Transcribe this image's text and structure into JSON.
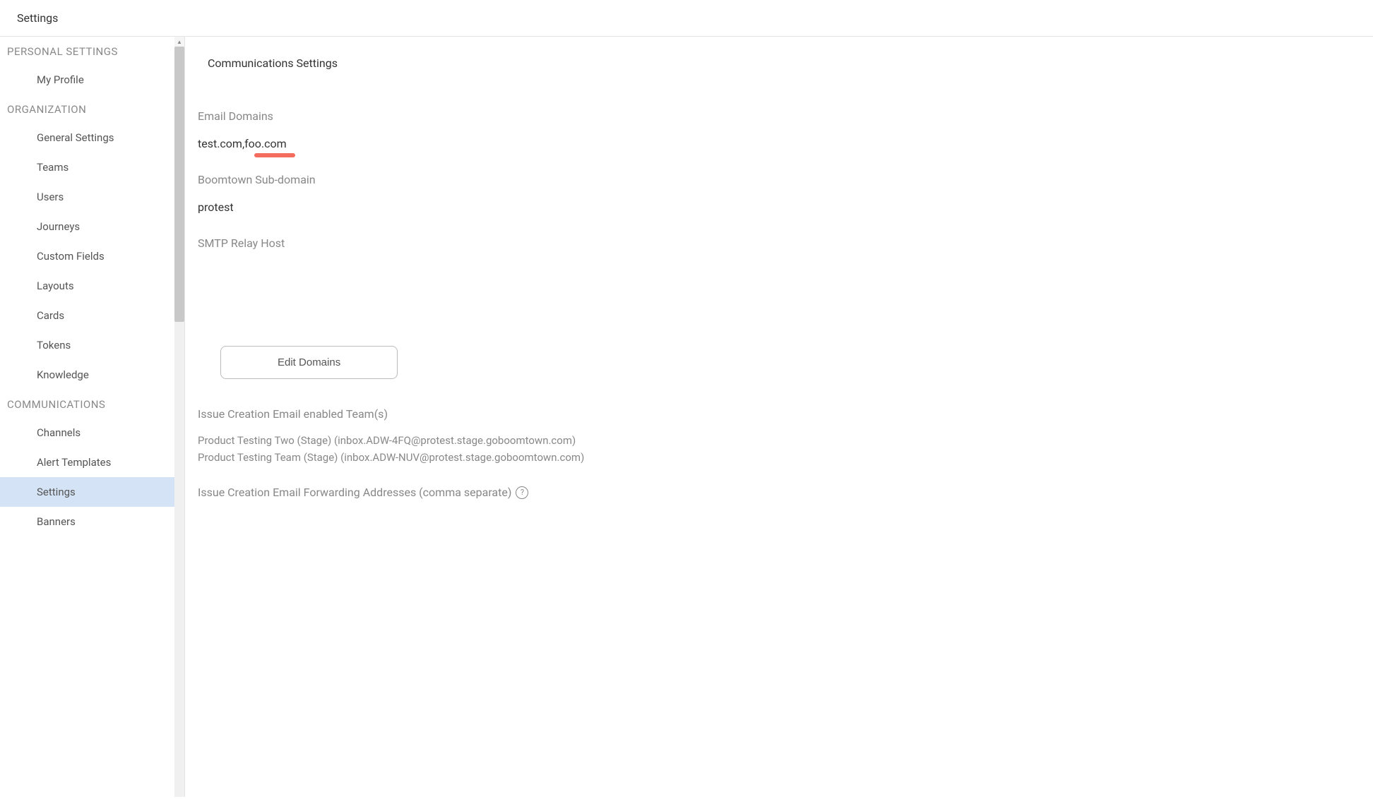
{
  "header": {
    "title": "Settings"
  },
  "sidebar": {
    "sections": [
      {
        "header": "PERSONAL SETTINGS",
        "items": [
          {
            "label": "My Profile",
            "key": "my-profile"
          }
        ]
      },
      {
        "header": "ORGANIZATION",
        "items": [
          {
            "label": "General Settings",
            "key": "general-settings"
          },
          {
            "label": "Teams",
            "key": "teams"
          },
          {
            "label": "Users",
            "key": "users"
          },
          {
            "label": "Journeys",
            "key": "journeys"
          },
          {
            "label": "Custom Fields",
            "key": "custom-fields"
          },
          {
            "label": "Layouts",
            "key": "layouts"
          },
          {
            "label": "Cards",
            "key": "cards"
          },
          {
            "label": "Tokens",
            "key": "tokens"
          },
          {
            "label": "Knowledge",
            "key": "knowledge"
          }
        ]
      },
      {
        "header": "COMMUNICATIONS",
        "items": [
          {
            "label": "Channels",
            "key": "channels"
          },
          {
            "label": "Alert Templates",
            "key": "alert-templates"
          },
          {
            "label": "Settings",
            "key": "settings",
            "active": true
          },
          {
            "label": "Banners",
            "key": "banners"
          }
        ]
      }
    ]
  },
  "main": {
    "title": "Communications Settings",
    "emailDomains": {
      "label": "Email Domains",
      "value": "test.com,foo.com"
    },
    "subdomain": {
      "label": "Boomtown Sub-domain",
      "value": "protest"
    },
    "smtp": {
      "label": "SMTP Relay Host",
      "value": ""
    },
    "editButton": "Edit Domains",
    "enabledTeams": {
      "label": "Issue Creation Email enabled Team(s)",
      "lines": [
        "Product Testing Two (Stage) (inbox.ADW-4FQ@protest.stage.goboomtown.com)",
        "Product Testing Team (Stage) (inbox.ADW-NUV@protest.stage.goboomtown.com)"
      ]
    },
    "forwarding": {
      "label": "Issue Creation Email Forwarding Addresses (comma separate)"
    }
  }
}
